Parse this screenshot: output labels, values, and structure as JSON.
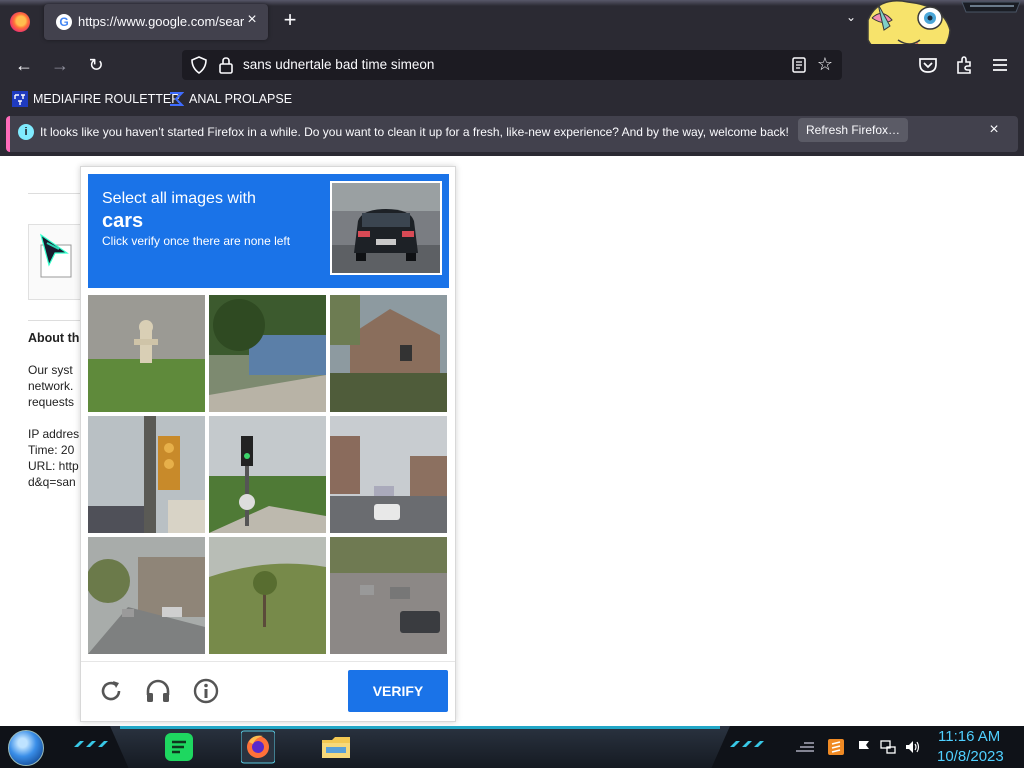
{
  "browser": {
    "tab": {
      "title": "https://www.google.com/search",
      "close_glyph": "×"
    },
    "new_tab_glyph": "+",
    "tab_list_glyph": "⌄",
    "nav": {
      "back_glyph": "←",
      "forward_glyph": "→",
      "reload_glyph": "↻"
    },
    "urlbar": {
      "value": "sans udnertale bad time simeon",
      "bookmark_star_glyph": "☆"
    },
    "bookmarks": [
      {
        "label": "MEDIAFIRE ROULETTER",
        "icon": "mediafire-icon"
      },
      {
        "label": "ANAL PROLAPSE",
        "icon": "sigma-icon"
      }
    ],
    "notification": {
      "message": "It looks like you haven’t started Firefox in a while. Do you want to clean it up for a fresh, like-new experience? And by the way, welcome back!",
      "button_label": "Refresh Firefox…",
      "info_glyph": "i",
      "close_glyph": "×"
    }
  },
  "page": {
    "about_heading": "About th",
    "paragraph_lines": [
      "Our syst",
      "network.",
      "requests"
    ],
    "details_lines": [
      "IP addres",
      "Time: 20",
      "URL: http",
      "d&q=san"
    ]
  },
  "captcha": {
    "instruction_line1": "Select all images with",
    "target": "cars",
    "instruction_line2": "Click verify once there are none left",
    "verify_label": "VERIFY",
    "icons": [
      "reload-icon",
      "audio-headphones-icon",
      "info-icon"
    ]
  },
  "taskbar": {
    "time": "11:16 AM",
    "date": "10/8/2023",
    "apps": [
      "start-orb",
      "spotify-icon",
      "firefox-icon",
      "file-explorer-icon"
    ]
  },
  "colors": {
    "chrome_bg": "#2b2a33",
    "captcha_blue": "#1a73e8",
    "clock_cyan": "#4fd0ff"
  }
}
